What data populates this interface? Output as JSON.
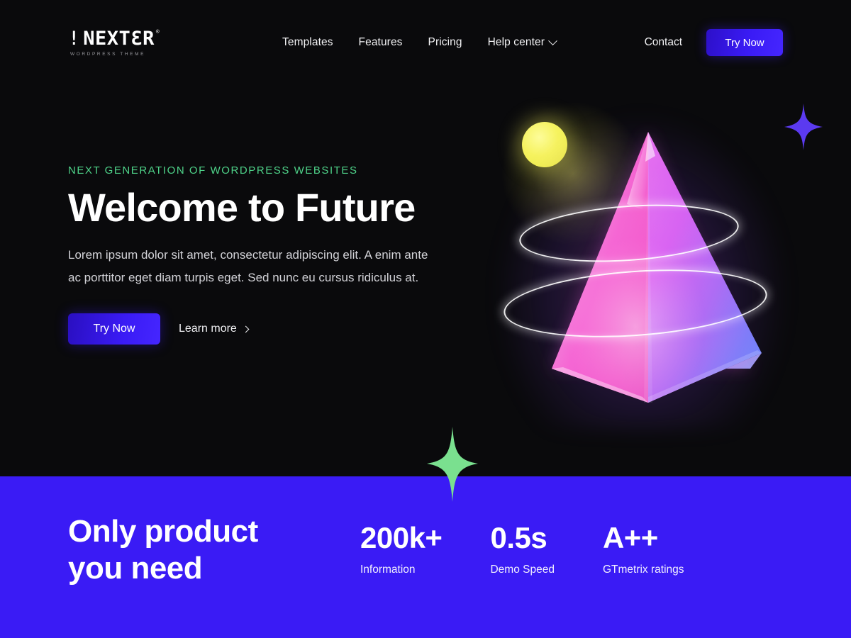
{
  "brand": {
    "logo_text": "!NEXT3R",
    "logo_prefix": "!",
    "logo_word_a": "NEXT",
    "logo_word_rev": "3",
    "logo_word_b": "R",
    "logo_tm": "®",
    "logo_subtitle": "WORDPRESS THEME"
  },
  "header": {
    "nav": [
      {
        "label": "Templates",
        "has_chevron": false
      },
      {
        "label": "Features",
        "has_chevron": false
      },
      {
        "label": "Pricing",
        "has_chevron": false
      },
      {
        "label": "Help center",
        "has_chevron": true
      }
    ],
    "contact_label": "Contact",
    "cta_label": "Try Now"
  },
  "hero": {
    "eyebrow": "NEXT GENERATION OF WORDPRESS WEBSITES",
    "headline": "Welcome to Future",
    "paragraph": "Lorem ipsum dolor sit amet, consectetur adipiscing elit. A enim ante ac porttitor eget diam turpis eget. Sed nunc eu cursus ridiculus at.",
    "primary_cta": "Try Now",
    "secondary_cta": "Learn more"
  },
  "artwork": {
    "pyramid_name": "3d-pyramid",
    "sphere_name": "yellow-sphere",
    "ring_count": 2,
    "star_purple_name": "sparkle-purple",
    "star_green_name": "sparkle-green"
  },
  "stats_band": {
    "title": "Only product\nyou need",
    "title_line1": "Only product",
    "title_line2": "you need",
    "items": [
      {
        "value": "200k+",
        "label": "Information"
      },
      {
        "value": "0.5s",
        "label": "Demo Speed"
      },
      {
        "value": "A++",
        "label": "GTmetrix ratings"
      }
    ]
  },
  "colors": {
    "background_dark": "#0a0a0c",
    "band_blue": "#3a1bf5",
    "accent_green": "#4fd48a",
    "sphere_yellow": "#f6f35f",
    "star_purple": "#5b3af0",
    "star_green": "#7ae08f",
    "text_primary": "#ffffff",
    "text_muted": "#d3d3d8"
  }
}
